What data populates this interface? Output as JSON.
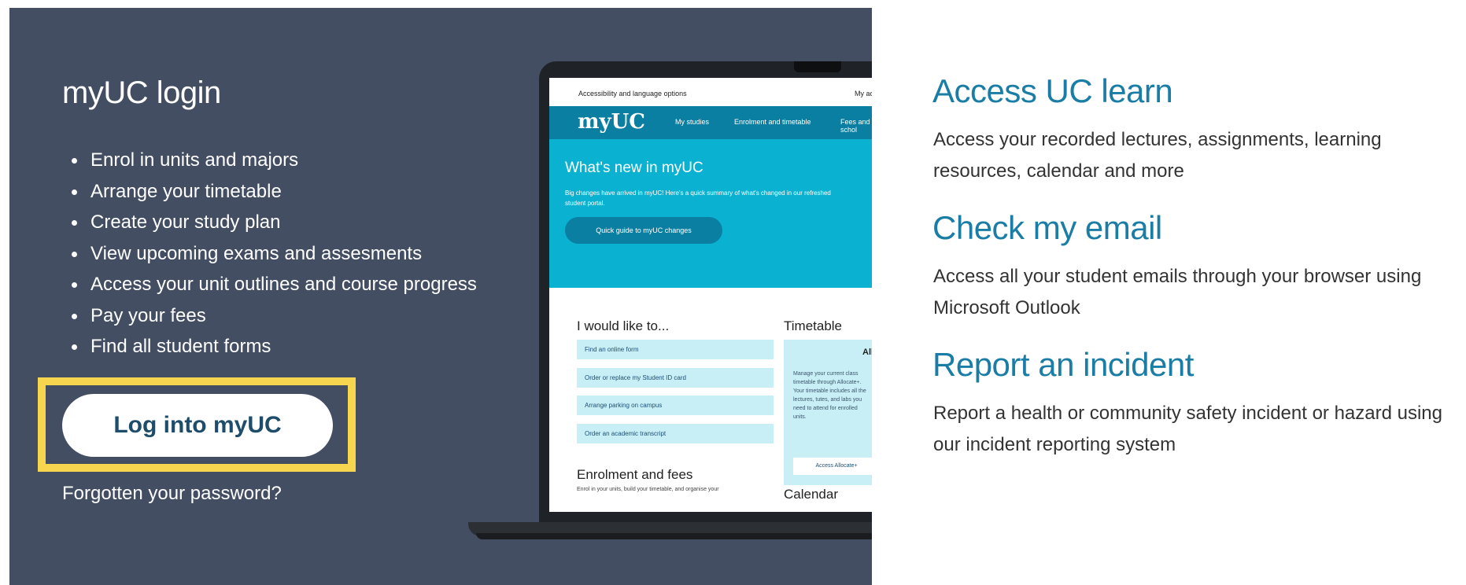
{
  "login": {
    "title": "myUC login",
    "features": [
      "Enrol in units and majors",
      "Arrange your timetable",
      "Create your study plan",
      "View upcoming exams and assesments",
      "Access your unit outlines and course progress",
      "Pay your fees",
      "Find all student forms"
    ],
    "button_label": "Log into myUC",
    "forgot_label": "Forgotten your password?"
  },
  "screen": {
    "a11y": "Accessibility and language options",
    "my_account": "My ac",
    "logo": "myUC",
    "nav": [
      "My studies",
      "Enrolment and timetable",
      "Fees and schol"
    ],
    "hero_title": "What's new in myUC",
    "hero_text": "Big changes have arrived in myUC! Here's a quick summary of what's changed in our refreshed student portal.",
    "hero_button": "Quick guide to myUC changes",
    "would_like_title": "I would like to...",
    "actions": [
      "Find an online form",
      "Order or replace my Student ID card",
      "Arrange parking on campus",
      "Order an academic transcript"
    ],
    "timetable_title": "Timetable",
    "alloc_title": "Alloc",
    "alloc_text": "Manage your current class timetable through Allocate+. Your timetable includes all the lectures, tutes, and labs you need to attend for enrolled units.",
    "alloc_button": "Access Allocate+",
    "enrol_title": "Enrolment and fees",
    "enrol_text": "Enrol in your units, build your timetable, and organise your",
    "calendar_title": "Calendar"
  },
  "links": [
    {
      "title": "Access UC learn",
      "description": "Access your recorded lectures, assignments, learning resources, calendar and more"
    },
    {
      "title": "Check my email",
      "description": "Access all your student emails through your browser using Microsoft Outlook"
    },
    {
      "title": "Report an incident",
      "description": "Report a health or community safety incident or hazard using our incident reporting system"
    }
  ],
  "colors": {
    "panel_bg": "#434e63",
    "highlight": "#f7d54f",
    "link_title": "#1a7da6",
    "button_text": "#1e4d6b"
  }
}
